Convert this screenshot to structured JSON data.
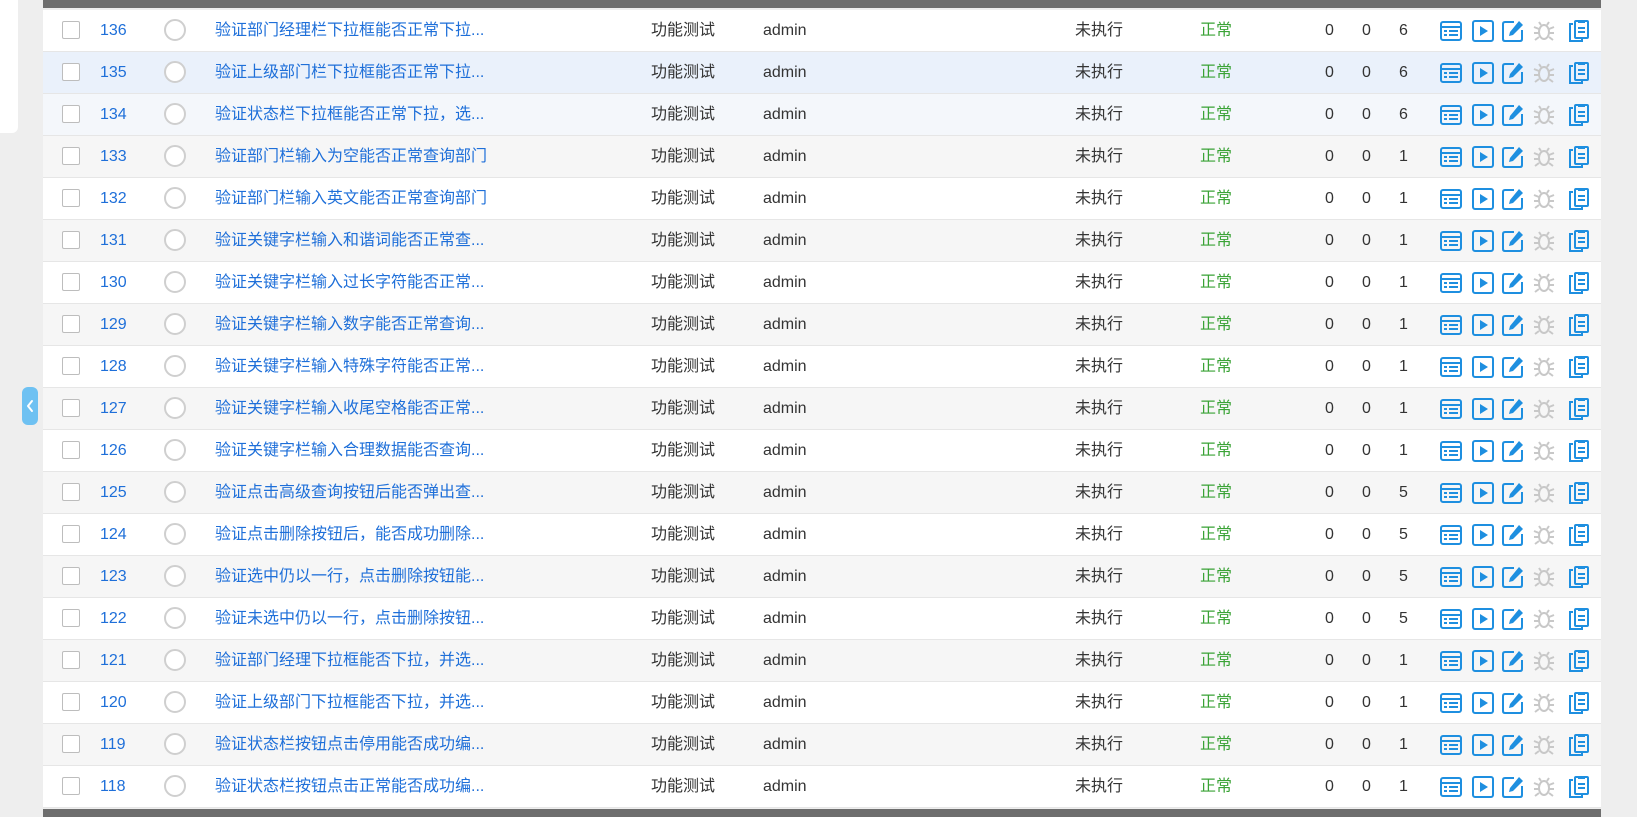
{
  "colors": {
    "link": "#1e6fd9",
    "status_ok": "#3aa336",
    "icon_blue": "#1e8fe0",
    "icon_gray": "#c8c8c8",
    "bar": "#6e6e6e"
  },
  "icons": {
    "detail": "list-icon",
    "run": "play-icon",
    "edit": "edit-icon",
    "bug": "bug-icon",
    "copy": "copy-icon",
    "collapse": "chevron-left-icon"
  },
  "rows": [
    {
      "id": "136",
      "title": "验证部门经理栏下拉框能否正常下拉...",
      "type": "功能测试",
      "owner": "admin",
      "exec": "未执行",
      "status": "正常",
      "c1": "0",
      "c2": "0",
      "c3": "6"
    },
    {
      "id": "135",
      "title": "验证上级部门栏下拉框能否正常下拉...",
      "type": "功能测试",
      "owner": "admin",
      "exec": "未执行",
      "status": "正常",
      "c1": "0",
      "c2": "0",
      "c3": "6"
    },
    {
      "id": "134",
      "title": "验证状态栏下拉框能否正常下拉，选...",
      "type": "功能测试",
      "owner": "admin",
      "exec": "未执行",
      "status": "正常",
      "c1": "0",
      "c2": "0",
      "c3": "6"
    },
    {
      "id": "133",
      "title": "验证部门栏输入为空能否正常查询部门",
      "type": "功能测试",
      "owner": "admin",
      "exec": "未执行",
      "status": "正常",
      "c1": "0",
      "c2": "0",
      "c3": "1"
    },
    {
      "id": "132",
      "title": "验证部门栏输入英文能否正常查询部门",
      "type": "功能测试",
      "owner": "admin",
      "exec": "未执行",
      "status": "正常",
      "c1": "0",
      "c2": "0",
      "c3": "1"
    },
    {
      "id": "131",
      "title": "验证关键字栏输入和谐词能否正常查...",
      "type": "功能测试",
      "owner": "admin",
      "exec": "未执行",
      "status": "正常",
      "c1": "0",
      "c2": "0",
      "c3": "1"
    },
    {
      "id": "130",
      "title": "验证关键字栏输入过长字符能否正常...",
      "type": "功能测试",
      "owner": "admin",
      "exec": "未执行",
      "status": "正常",
      "c1": "0",
      "c2": "0",
      "c3": "1"
    },
    {
      "id": "129",
      "title": "验证关键字栏输入数字能否正常查询...",
      "type": "功能测试",
      "owner": "admin",
      "exec": "未执行",
      "status": "正常",
      "c1": "0",
      "c2": "0",
      "c3": "1"
    },
    {
      "id": "128",
      "title": "验证关键字栏输入特殊字符能否正常...",
      "type": "功能测试",
      "owner": "admin",
      "exec": "未执行",
      "status": "正常",
      "c1": "0",
      "c2": "0",
      "c3": "1"
    },
    {
      "id": "127",
      "title": "验证关键字栏输入收尾空格能否正常...",
      "type": "功能测试",
      "owner": "admin",
      "exec": "未执行",
      "status": "正常",
      "c1": "0",
      "c2": "0",
      "c3": "1"
    },
    {
      "id": "126",
      "title": "验证关键字栏输入合理数据能否查询...",
      "type": "功能测试",
      "owner": "admin",
      "exec": "未执行",
      "status": "正常",
      "c1": "0",
      "c2": "0",
      "c3": "1"
    },
    {
      "id": "125",
      "title": "验证点击高级查询按钮后能否弹出查...",
      "type": "功能测试",
      "owner": "admin",
      "exec": "未执行",
      "status": "正常",
      "c1": "0",
      "c2": "0",
      "c3": "5"
    },
    {
      "id": "124",
      "title": "验证点击删除按钮后，能否成功删除...",
      "type": "功能测试",
      "owner": "admin",
      "exec": "未执行",
      "status": "正常",
      "c1": "0",
      "c2": "0",
      "c3": "5"
    },
    {
      "id": "123",
      "title": "验证选中仍以一行，点击删除按钮能...",
      "type": "功能测试",
      "owner": "admin",
      "exec": "未执行",
      "status": "正常",
      "c1": "0",
      "c2": "0",
      "c3": "5"
    },
    {
      "id": "122",
      "title": "验证未选中仍以一行，点击删除按钮...",
      "type": "功能测试",
      "owner": "admin",
      "exec": "未执行",
      "status": "正常",
      "c1": "0",
      "c2": "0",
      "c3": "5"
    },
    {
      "id": "121",
      "title": "验证部门经理下拉框能否下拉，并选...",
      "type": "功能测试",
      "owner": "admin",
      "exec": "未执行",
      "status": "正常",
      "c1": "0",
      "c2": "0",
      "c3": "1"
    },
    {
      "id": "120",
      "title": "验证上级部门下拉框能否下拉，并选...",
      "type": "功能测试",
      "owner": "admin",
      "exec": "未执行",
      "status": "正常",
      "c1": "0",
      "c2": "0",
      "c3": "1"
    },
    {
      "id": "119",
      "title": "验证状态栏按钮点击停用能否成功编...",
      "type": "功能测试",
      "owner": "admin",
      "exec": "未执行",
      "status": "正常",
      "c1": "0",
      "c2": "0",
      "c3": "1"
    },
    {
      "id": "118",
      "title": "验证状态栏按钮点击正常能否成功编...",
      "type": "功能测试",
      "owner": "admin",
      "exec": "未执行",
      "status": "正常",
      "c1": "0",
      "c2": "0",
      "c3": "1"
    }
  ]
}
